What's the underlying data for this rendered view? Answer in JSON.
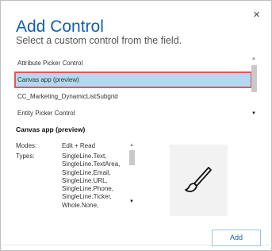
{
  "dialog": {
    "title": "Add Control",
    "subtitle": "Select a custom control from the field.",
    "close_glyph": "×",
    "close_icon": "close-icon"
  },
  "controls_list": {
    "items": [
      {
        "label": "Attribute Picker Control",
        "selected": false
      },
      {
        "label": "Canvas app (preview)",
        "selected": true
      },
      {
        "label": "CC_Marketing_DynamicListSubgrid",
        "selected": false
      },
      {
        "label": "Entity Picker Control",
        "selected": false
      }
    ],
    "scroll_up_glyph": "▲",
    "scroll_down_glyph": "▼"
  },
  "details": {
    "title": "Canvas app (preview)",
    "modes_label": "Modes:",
    "modes_value": "Edit + Read",
    "types_label": "Types:",
    "types_values": [
      "SingleLine.Text,",
      "SingleLine.TextArea,",
      "SingleLine.Email,",
      "SingleLine.URL,",
      "SingleLine.Phone,",
      "SingleLine.Ticker,",
      "Whole.None,"
    ],
    "scroll_up_glyph": "▲",
    "scroll_down_glyph": "▼",
    "preview_icon": "paintbrush-icon"
  },
  "footer": {
    "add_label": "Add"
  },
  "colors": {
    "title": "#1160b7",
    "selected_bg": "#b6d7f0",
    "selected_border": "#e0585c",
    "button_border": "#9cc4e4"
  }
}
